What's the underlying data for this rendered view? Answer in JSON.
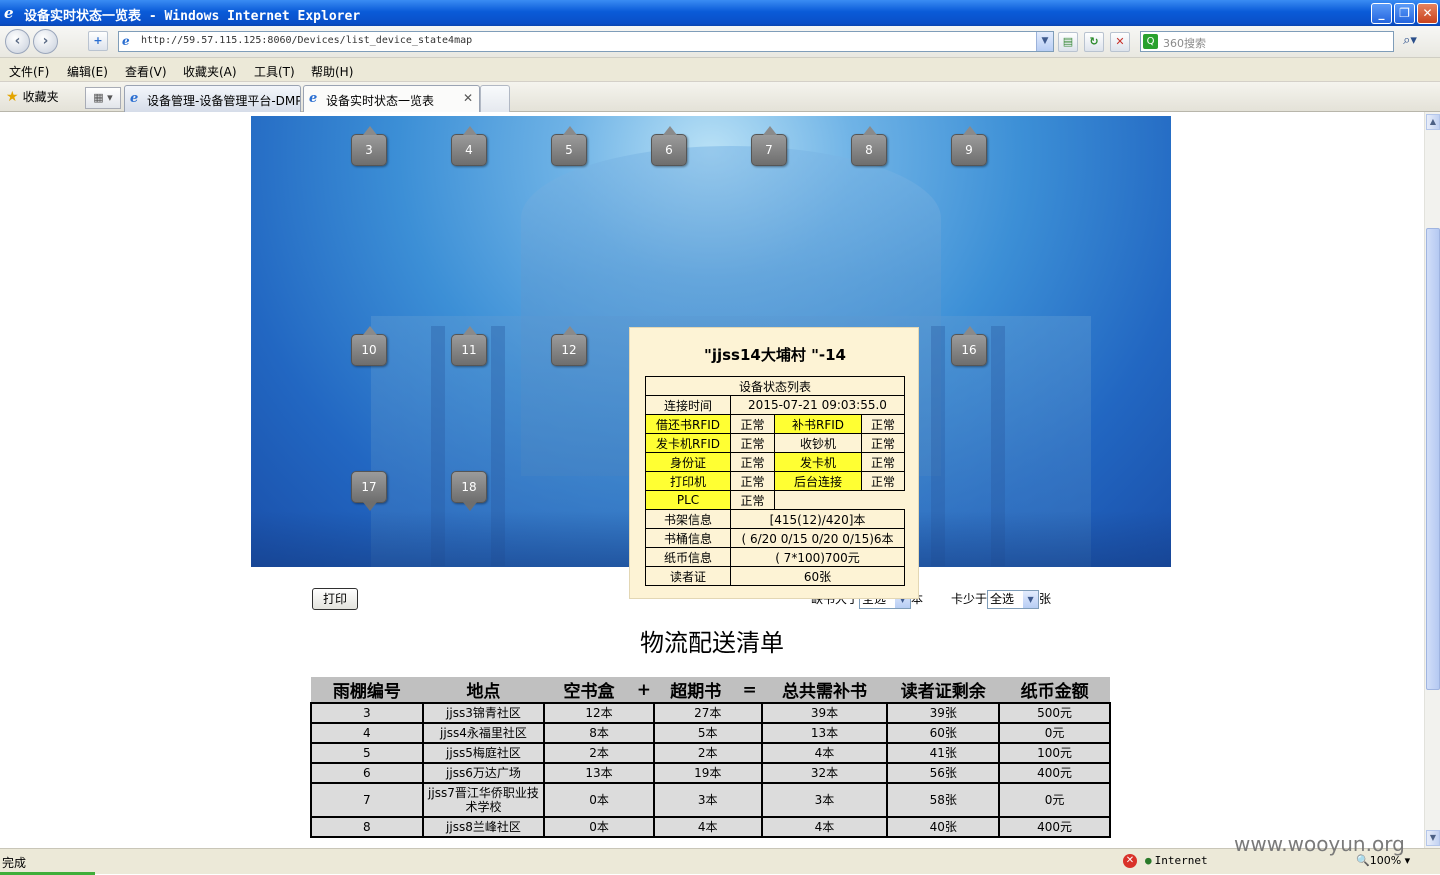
{
  "window": {
    "title": "设备实时状态一览表 - Windows Internet Explorer",
    "min_label": "_",
    "max_label": "❐",
    "close_label": "✕"
  },
  "address": {
    "url": "http://59.57.115.125:8060/Devices/list_device_state4map",
    "search_placeholder": "360搜索"
  },
  "menu": [
    "文件(F)",
    "编辑(E)",
    "查看(V)",
    "收藏夹(A)",
    "工具(T)",
    "帮助(H)"
  ],
  "favorites_label": "收藏夹",
  "tabs": [
    {
      "label": "设备管理-设备管理平台-DMP",
      "active": false
    },
    {
      "label": "设备实时状态一览表",
      "active": true
    }
  ],
  "markers": [
    "3",
    "4",
    "5",
    "6",
    "7",
    "8",
    "9",
    "10",
    "11",
    "12",
    "16",
    "17",
    "18"
  ],
  "popup": {
    "title": "\"jjss14大埔村 \"-14",
    "header": "设备状态列表",
    "connect_label": "连接时间",
    "connect_value": "2015-07-21 09:03:55.0",
    "devices": [
      [
        "借还书RFID",
        "正常",
        "补书RFID",
        "正常"
      ],
      [
        "发卡机RFID",
        "正常",
        "收钞机",
        "正常"
      ],
      [
        "身份证",
        "正常",
        "发卡机",
        "正常"
      ],
      [
        "打印机",
        "正常",
        "后台连接",
        "正常"
      ]
    ],
    "plc_label": "PLC",
    "plc_value": "正常",
    "info": [
      [
        "书架信息",
        "[415(12)/420]本"
      ],
      [
        "书桶信息",
        "( 6/20 0/15 0/20 0/15)6本"
      ],
      [
        "纸币信息",
        "( 7*100)700元"
      ],
      [
        "读者证",
        "60张"
      ]
    ]
  },
  "controls": {
    "print_label": "打印",
    "book_filter_prefix": "缺书大于",
    "book_filter_value": "全选",
    "book_filter_suffix": "本",
    "card_filter_prefix": "卡少于",
    "card_filter_value": "全选",
    "card_filter_suffix": "张"
  },
  "heading": "物流配送清单",
  "table": {
    "headers": [
      "雨棚编号",
      "地点",
      "空书盒",
      "+",
      "超期书",
      "=",
      "总共需补书",
      "读者证剩余",
      "纸币金额"
    ],
    "rows": [
      [
        "3",
        "jjss3锦青社区",
        "12本",
        "27本",
        "39本",
        "39张",
        "500元"
      ],
      [
        "4",
        "jjss4永福里社区",
        "8本",
        "5本",
        "13本",
        "60张",
        "0元"
      ],
      [
        "5",
        "jjss5梅庭社区",
        "2本",
        "2本",
        "4本",
        "41张",
        "100元"
      ],
      [
        "6",
        "jjss6万达广场",
        "13本",
        "19本",
        "32本",
        "56张",
        "400元"
      ],
      [
        "7",
        "jjss7晋江华侨职业技术学校",
        "0本",
        "3本",
        "3本",
        "58张",
        "0元"
      ],
      [
        "8",
        "jjss8兰峰社区",
        "0本",
        "4本",
        "4本",
        "40张",
        "400元"
      ]
    ]
  },
  "status": {
    "text": "完成",
    "zone": "Internet",
    "zoom": "100%"
  },
  "watermark": "www.wooyun.org",
  "colors": {
    "highlight": "#ffff33",
    "popup_bg": "#fdf3d5",
    "marker": "#8a8a8a"
  }
}
